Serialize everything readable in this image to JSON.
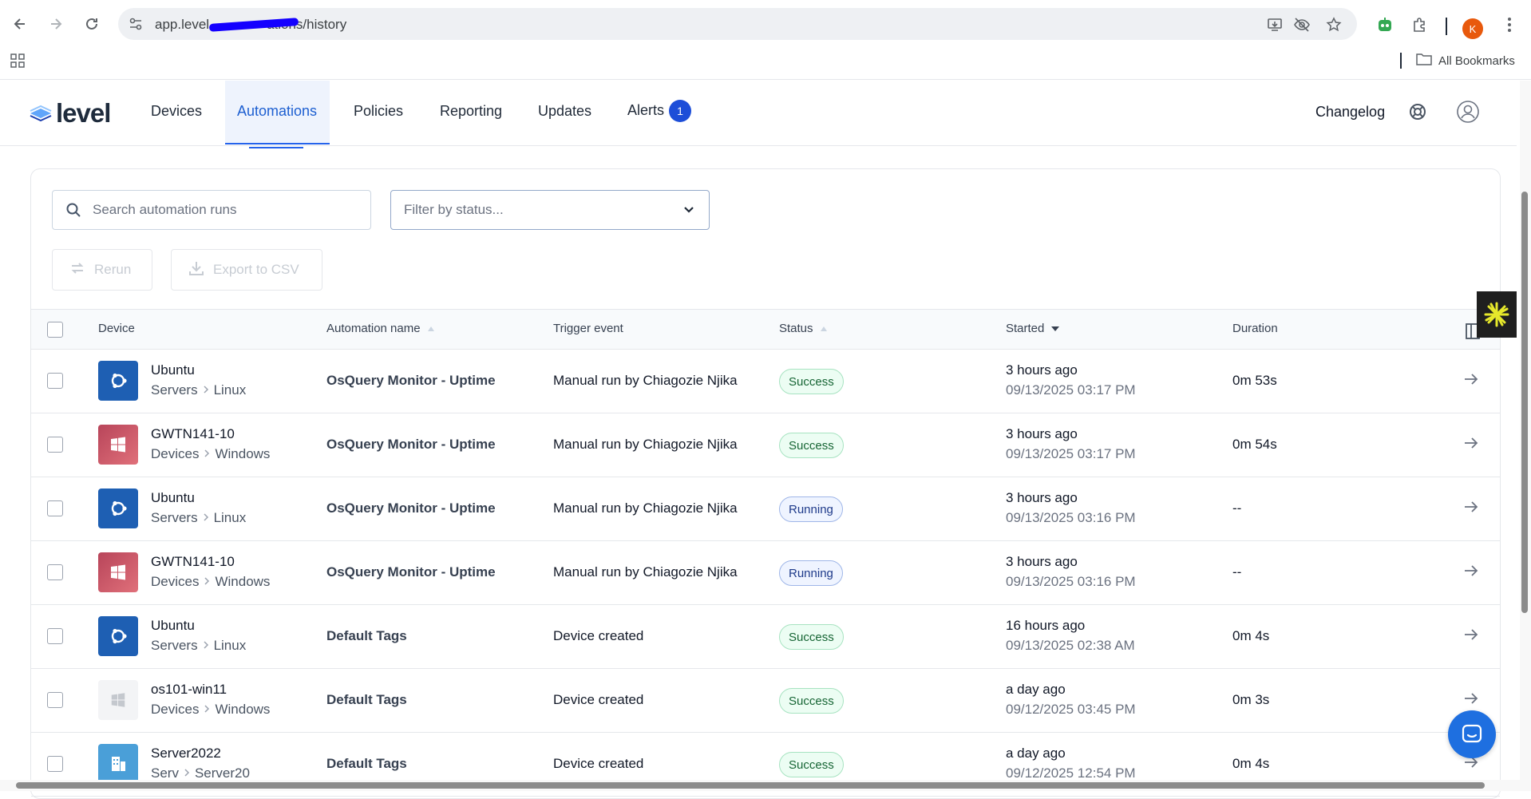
{
  "browser": {
    "url": "app.level.io/automations/history",
    "url_visible_prefix": "app.level",
    "url_visible_suffix": "ations/history",
    "profile_initial": "K",
    "all_bookmarks_label": "All Bookmarks"
  },
  "header": {
    "logo_text": "level",
    "nav": [
      {
        "label": "Devices"
      },
      {
        "label": "Automations",
        "active": true
      },
      {
        "label": "Policies"
      },
      {
        "label": "Reporting"
      },
      {
        "label": "Updates"
      },
      {
        "label": "Alerts",
        "badge": "1"
      }
    ],
    "changelog_label": "Changelog"
  },
  "filters": {
    "search_placeholder": "Search automation runs",
    "status_placeholder": "Filter by status..."
  },
  "actions": {
    "rerun_label": "Rerun",
    "export_label": "Export to CSV"
  },
  "table": {
    "columns": {
      "device": "Device",
      "automation": "Automation name",
      "trigger": "Trigger event",
      "status": "Status",
      "started": "Started",
      "duration": "Duration"
    },
    "rows": [
      {
        "icon": "linux",
        "device": "Ubuntu",
        "group": "Servers",
        "os": "Linux",
        "automation": "OsQuery Monitor - Uptime",
        "trigger": "Manual run by Chiagozie Njika",
        "status": "Success",
        "status_kind": "success",
        "started_rel": "3 hours ago",
        "started_abs": "09/13/2025 03:17 PM",
        "duration": "0m 53s"
      },
      {
        "icon": "win",
        "device": "GWTN141-10",
        "group": "Devices",
        "os": "Windows",
        "automation": "OsQuery Monitor - Uptime",
        "trigger": "Manual run by Chiagozie Njika",
        "status": "Success",
        "status_kind": "success",
        "started_rel": "3 hours ago",
        "started_abs": "09/13/2025 03:17 PM",
        "duration": "0m 54s"
      },
      {
        "icon": "linux",
        "device": "Ubuntu",
        "group": "Servers",
        "os": "Linux",
        "automation": "OsQuery Monitor - Uptime",
        "trigger": "Manual run by Chiagozie Njika",
        "status": "Running",
        "status_kind": "running",
        "started_rel": "3 hours ago",
        "started_abs": "09/13/2025 03:16 PM",
        "duration": "--"
      },
      {
        "icon": "win",
        "device": "GWTN141-10",
        "group": "Devices",
        "os": "Windows",
        "automation": "OsQuery Monitor - Uptime",
        "trigger": "Manual run by Chiagozie Njika",
        "status": "Running",
        "status_kind": "running",
        "started_rel": "3 hours ago",
        "started_abs": "09/13/2025 03:16 PM",
        "duration": "--"
      },
      {
        "icon": "linux",
        "device": "Ubuntu",
        "group": "Servers",
        "os": "Linux",
        "automation": "Default Tags",
        "trigger": "Device created",
        "status": "Success",
        "status_kind": "success",
        "started_rel": "16 hours ago",
        "started_abs": "09/13/2025 02:38 AM",
        "duration": "0m 4s"
      },
      {
        "icon": "plain",
        "device": "os101-win11",
        "group": "Devices",
        "os": "Windows",
        "automation": "Default Tags",
        "trigger": "Device created",
        "status": "Success",
        "status_kind": "success",
        "started_rel": "a day ago",
        "started_abs": "09/12/2025 03:45 PM",
        "duration": "0m 3s"
      },
      {
        "icon": "server",
        "device": "Server2022",
        "group": "Serv",
        "os": "Server20",
        "automation": "Default Tags",
        "trigger": "Device created",
        "status": "Success",
        "status_kind": "success",
        "started_rel": "a day ago",
        "started_abs": "09/12/2025 12:54 PM",
        "duration": "0m 4s"
      }
    ]
  },
  "colors": {
    "accent": "#2563eb",
    "success": "#166534",
    "running": "#1e3a8a"
  }
}
